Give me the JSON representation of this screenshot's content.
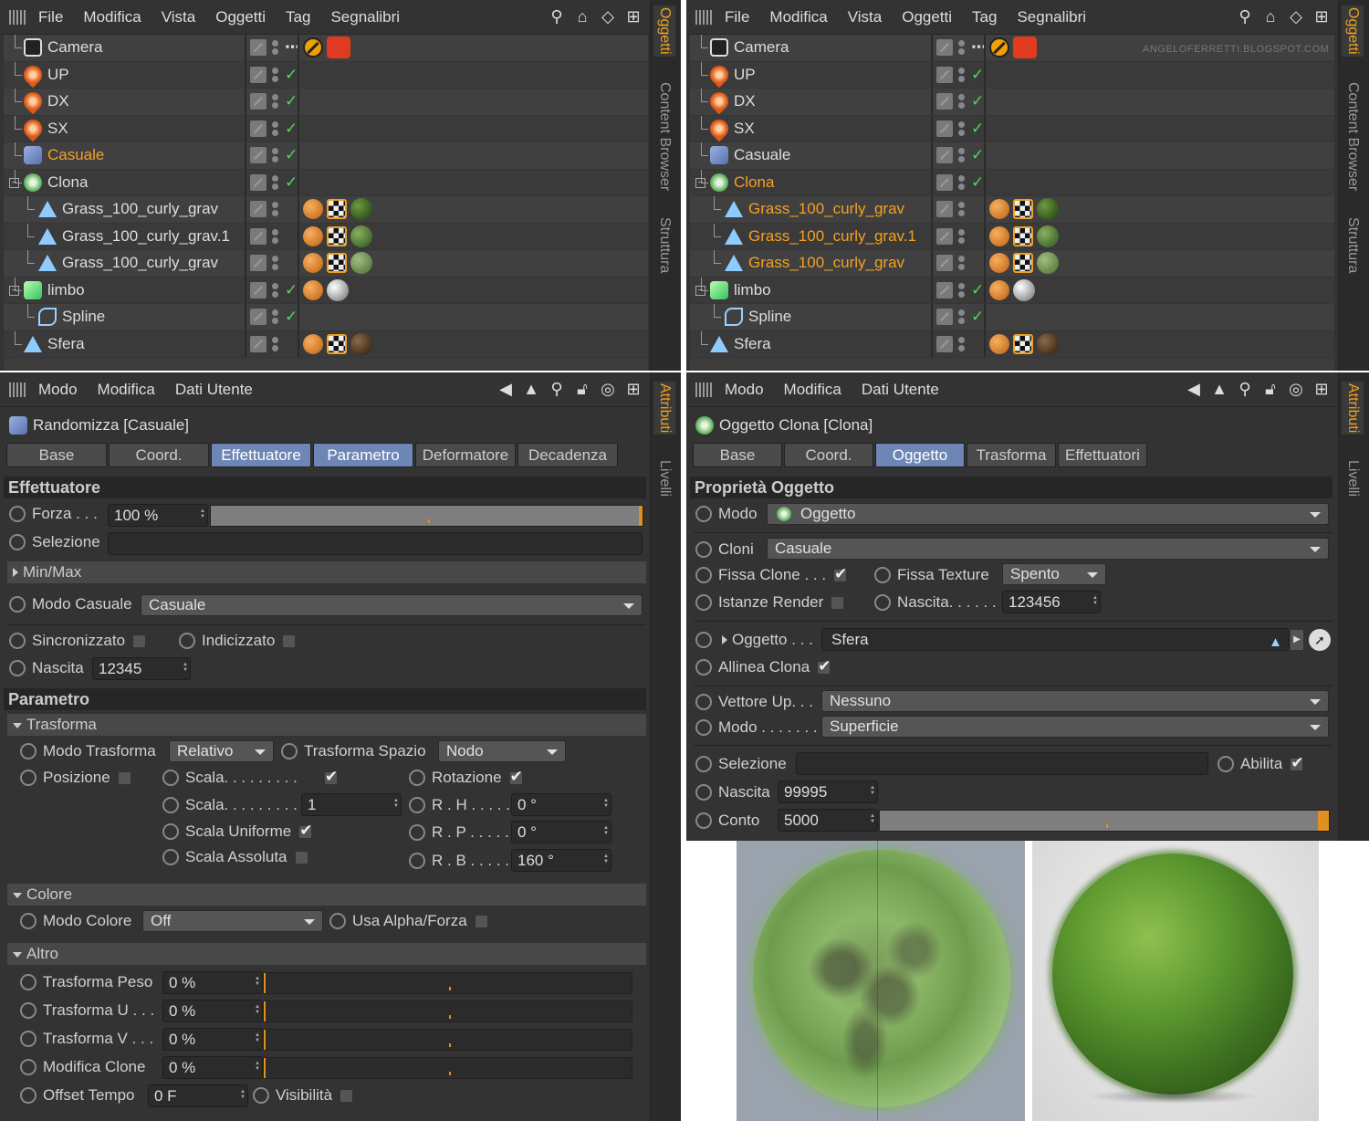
{
  "menu_top": [
    "File",
    "Modifica",
    "Vista",
    "Oggetti",
    "Tag",
    "Segnalibri"
  ],
  "menu_attr": [
    "Modo",
    "Modifica",
    "Dati Utente"
  ],
  "side_tabs_top": [
    "Oggetti",
    "Content Browser",
    "Struttura"
  ],
  "side_tabs_attr": [
    "Attributi",
    "Livelli"
  ],
  "watermark": "ANGELOFERRETTI.BLOGSPOT.COM",
  "left_objects": [
    {
      "name": "Camera",
      "icon": "camera-icon"
    },
    {
      "name": "UP",
      "icon": "light-icon"
    },
    {
      "name": "DX",
      "icon": "light-icon"
    },
    {
      "name": "SX",
      "icon": "light-icon"
    },
    {
      "name": "Casuale",
      "icon": "effector-icon"
    },
    {
      "name": "Clona",
      "icon": "cloner-icon"
    },
    {
      "name": "Grass_100_curly_grav",
      "icon": "mesh-icon"
    },
    {
      "name": "Grass_100_curly_grav.1",
      "icon": "mesh-icon"
    },
    {
      "name": "Grass_100_curly_grav",
      "icon": "mesh-icon"
    },
    {
      "name": "limbo",
      "icon": "object-icon"
    },
    {
      "name": "Spline",
      "icon": "spline-icon"
    },
    {
      "name": "Sfera",
      "icon": "mesh-icon"
    }
  ],
  "right_objects": [
    "Camera",
    "UP",
    "DX",
    "SX",
    "Casuale",
    "Clona",
    "Grass_100_curly_grav",
    "Grass_100_curly_grav.1",
    "Grass_100_curly_grav",
    "limbo",
    "Spline",
    "Sfera"
  ],
  "left_attr": {
    "title": "Randomizza [Casuale]",
    "tabs": [
      "Base",
      "Coord.",
      "Effettuatore",
      "Parametro",
      "Deformatore",
      "Decadenza"
    ],
    "section1": "Effettuatore",
    "forza_label": "Forza . . .",
    "forza_value": "100 %",
    "forza_fraction": 1.0,
    "selezione_label": "Selezione",
    "minmax": "Min/Max",
    "modo_casuale_label": "Modo Casuale",
    "modo_casuale_value": "Casuale",
    "sincronizzato": "Sincronizzato",
    "indicizzato": "Indicizzato",
    "nascita_label": "Nascita",
    "nascita_value": "12345",
    "section2": "Parametro",
    "trasforma": "Trasforma",
    "modo_trasforma_label": "Modo Trasforma",
    "modo_trasforma_value": "Relativo",
    "trasforma_spazio_label": "Trasforma Spazio",
    "trasforma_spazio_value": "Nodo",
    "posizione": "Posizione",
    "scala1": "Scala. . . . . . . . .",
    "rotazione": "Rotazione",
    "scala2": "Scala. . . . . . . . .",
    "scala2_value": "1",
    "rh": "R . H . . . . .",
    "rh_value": "0 °",
    "scala_uniforme": "Scala Uniforme",
    "rp": "R . P . . . . .",
    "rp_value": "0 °",
    "scala_assoluta": "Scala Assoluta",
    "rb": "R . B . . . . .",
    "rb_value": "160 °",
    "colore": "Colore",
    "modo_colore_label": "Modo Colore",
    "modo_colore_value": "Off",
    "usa_alpha": "Usa Alpha/Forza",
    "altro": "Altro",
    "trasforma_peso": "Trasforma Peso",
    "trasforma_u": "Trasforma U . . .",
    "trasforma_v": "Trasforma V . . .",
    "modifica_clone": "Modifica Clone",
    "pct0": "0 %",
    "offset_tempo": "Offset Tempo",
    "offset_value": "0 F",
    "visibilita": "Visibilità"
  },
  "right_attr": {
    "title": "Oggetto Clona [Clona]",
    "tabs": [
      "Base",
      "Coord.",
      "Oggetto",
      "Trasforma",
      "Effettuatori"
    ],
    "section1": "Proprietà Oggetto",
    "modo_label": "Modo",
    "modo_value": "Oggetto",
    "cloni_label": "Cloni",
    "cloni_value": "Casuale",
    "fissa_clone": "Fissa Clone . . .",
    "fissa_texture": "Fissa Texture",
    "fissa_texture_value": "Spento",
    "istanze_render": "Istanze Render",
    "nascita_label": "Nascita. . . . . .",
    "nascita_value": "123456",
    "oggetto_label": "Oggetto . . .",
    "oggetto_value": "Sfera",
    "allinea_clona": "Allinea Clona",
    "vettore_up_label": "Vettore Up. . .",
    "vettore_up_value": "Nessuno",
    "modo2_label": "Modo . . . . . . .",
    "modo2_value": "Superficie",
    "selezione_label": "Selezione",
    "abilita": "Abilita",
    "nascita2_label": "Nascita",
    "nascita2_value": "99995",
    "conto_label": "Conto",
    "conto_value": "5000",
    "conto_fraction": 1.0
  },
  "colors": {
    "accent": "#f0a020",
    "tab_active": "#6d86b5",
    "check": "#5ad35a"
  }
}
